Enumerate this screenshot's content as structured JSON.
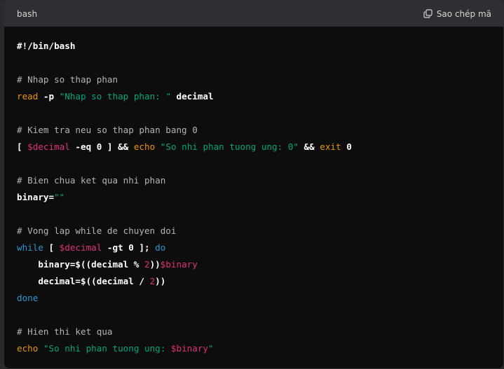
{
  "header": {
    "language": "bash",
    "copy_label": "Sao chép mã",
    "copy_icon": "copy-icon"
  },
  "colors": {
    "background": "#0d0d0d",
    "header_bg": "#2f2f33",
    "comment": "#b4b4b4",
    "keyword_orange": "#e9950c",
    "keyword_blue": "#2e95d3",
    "string": "#00a67d",
    "variable": "#df3079"
  },
  "code_lines": [
    [
      {
        "t": "#!/bin/bash",
        "c": "op"
      }
    ],
    [],
    [
      {
        "t": "# Nhap so thap phan",
        "c": "comment"
      }
    ],
    [
      {
        "t": "read",
        "c": "kw-orange"
      },
      {
        "t": " -p ",
        "c": "op"
      },
      {
        "t": "\"Nhap so thap phan: \"",
        "c": "str"
      },
      {
        "t": " decimal",
        "c": "op"
      }
    ],
    [],
    [
      {
        "t": "# Kiem tra neu so thap phan bang 0",
        "c": "comment"
      }
    ],
    [
      {
        "t": "[ ",
        "c": "op"
      },
      {
        "t": "$decimal",
        "c": "var"
      },
      {
        "t": " -eq 0 ] && ",
        "c": "op"
      },
      {
        "t": "echo",
        "c": "kw-orange"
      },
      {
        "t": " ",
        "c": "op"
      },
      {
        "t": "\"So nhi phan tuong ung: 0\"",
        "c": "str"
      },
      {
        "t": " && ",
        "c": "op"
      },
      {
        "t": "exit",
        "c": "kw-orange"
      },
      {
        "t": " 0",
        "c": "op"
      }
    ],
    [],
    [
      {
        "t": "# Bien chua ket qua nhi phan",
        "c": "comment"
      }
    ],
    [
      {
        "t": "binary=",
        "c": "op"
      },
      {
        "t": "\"\"",
        "c": "str"
      }
    ],
    [],
    [
      {
        "t": "# Vong lap while de chuyen doi",
        "c": "comment"
      }
    ],
    [
      {
        "t": "while",
        "c": "kw-blue"
      },
      {
        "t": " [ ",
        "c": "op"
      },
      {
        "t": "$decimal",
        "c": "var"
      },
      {
        "t": " -gt 0 ]; ",
        "c": "op"
      },
      {
        "t": "do",
        "c": "kw-blue"
      }
    ],
    [
      {
        "t": "    binary=$((decimal % ",
        "c": "op"
      },
      {
        "t": "2",
        "c": "num"
      },
      {
        "t": "))",
        "c": "op"
      },
      {
        "t": "$binary",
        "c": "var"
      }
    ],
    [
      {
        "t": "    decimal=$((decimal / ",
        "c": "op"
      },
      {
        "t": "2",
        "c": "num"
      },
      {
        "t": "))",
        "c": "op"
      }
    ],
    [
      {
        "t": "done",
        "c": "kw-blue"
      }
    ],
    [],
    [
      {
        "t": "# Hien thi ket qua",
        "c": "comment"
      }
    ],
    [
      {
        "t": "echo",
        "c": "kw-orange"
      },
      {
        "t": " ",
        "c": "op"
      },
      {
        "t": "\"So nhi phan tuong ung: ",
        "c": "str"
      },
      {
        "t": "$binary",
        "c": "var"
      },
      {
        "t": "\"",
        "c": "str"
      }
    ]
  ]
}
